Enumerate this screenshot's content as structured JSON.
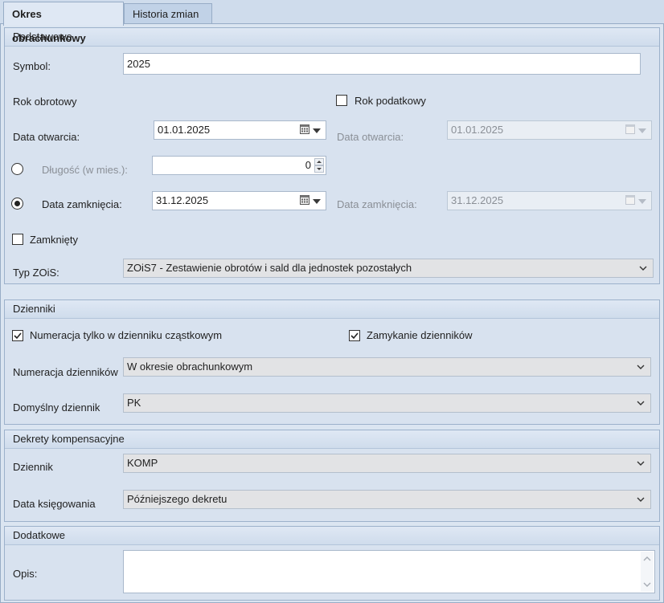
{
  "tabs": [
    {
      "label": "Okres obrachunkowy",
      "active": true
    },
    {
      "label": "Historia zmian",
      "active": false
    }
  ],
  "podstawowe": {
    "header": "Podstawowe",
    "symbol_label": "Symbol:",
    "symbol_value": "2025",
    "rok_obrotowy_label": "Rok obrotowy",
    "rok_podatkowy_label": "Rok podatkowy",
    "rok_podatkowy_checked": false,
    "data_otwarcia_label": "Data otwarcia:",
    "data_otwarcia_value": "01.01.2025",
    "data_otwarcia_pod_label": "Data otwarcia:",
    "data_otwarcia_pod_value": "01.01.2025",
    "dlugosc_label": "Długość (w mies.):",
    "dlugosc_value": "0",
    "dlugosc_selected": false,
    "data_zamkniecia_label": "Data zamknięcia:",
    "data_zamkniecia_value": "31.12.2025",
    "data_zamkniecia_selected": true,
    "data_zamkniecia_pod_label": "Data zamknięcia:",
    "data_zamkniecia_pod_value": "31.12.2025",
    "zamkniety_label": "Zamknięty",
    "zamkniety_checked": false,
    "typ_zois_label": "Typ ZOiS:",
    "typ_zois_value": "ZOiS7 - Zestawienie obrotów i sald dla jednostek pozostałych"
  },
  "dzienniki": {
    "header": "Dzienniki",
    "numeracja_tylko_label": "Numeracja tylko w dzienniku cząstkowym",
    "numeracja_tylko_checked": true,
    "zamykanie_label": "Zamykanie dzienników",
    "zamykanie_checked": true,
    "numeracja_label": "Numeracja dzienników",
    "numeracja_value": "W okresie obrachunkowym",
    "domyslny_label": "Domyślny dziennik",
    "domyslny_value": "PK"
  },
  "dekrety": {
    "header": "Dekrety kompensacyjne",
    "dziennik_label": "Dziennik",
    "dziennik_value": "KOMP",
    "data_ksiegowania_label": "Data księgowania",
    "data_ksiegowania_value": "Późniejszego dekretu"
  },
  "dodatkowe": {
    "header": "Dodatkowe",
    "opis_label": "Opis:",
    "opis_value": ""
  },
  "colors": {
    "background": "#cfdcec",
    "panel": "#dbe5f1",
    "combo": "#e2e3e5",
    "disabled_text": "#8a8f96"
  }
}
